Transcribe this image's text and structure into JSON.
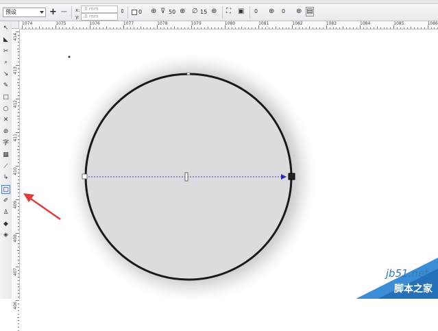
{
  "toolbar": {
    "preset_label": "预设",
    "offset_x": ".0 mm",
    "offset_y": ".0 mm",
    "angle_value": "0",
    "midpoint_value": "50",
    "edge_pad_value": "15",
    "rotation_value": "0",
    "spin_value": "0"
  },
  "ruler": {
    "h_labels": [
      "1074",
      "1075",
      "1076",
      "1077",
      "1078",
      "1079",
      "1080",
      "1081",
      "1082",
      "1083",
      "1084",
      "1085",
      "1086"
    ],
    "v_labels": [
      "414",
      "413",
      "412",
      "411",
      "410",
      "409",
      "408",
      "407",
      "406"
    ]
  },
  "toolbox": {
    "items": [
      {
        "name": "pick-tool",
        "glyph": "↖",
        "active": false
      },
      {
        "name": "shape-tool",
        "glyph": "◣",
        "active": false
      },
      {
        "name": "crop-tool",
        "glyph": "✂",
        "active": false
      },
      {
        "name": "zoom-tool",
        "glyph": "⌕",
        "active": false
      },
      {
        "name": "freehand-tool",
        "glyph": "↘",
        "active": false
      },
      {
        "name": "smart-fill-tool",
        "glyph": "✎",
        "active": false
      },
      {
        "name": "rectangle-tool",
        "glyph": "□",
        "active": false
      },
      {
        "name": "ellipse-tool",
        "glyph": "○",
        "active": false
      },
      {
        "name": "polygon-tool",
        "glyph": "✕",
        "active": false
      },
      {
        "name": "basic-shapes-tool",
        "glyph": "⊛",
        "active": false
      },
      {
        "name": "text-tool",
        "glyph": "字",
        "active": false
      },
      {
        "name": "table-tool",
        "glyph": "▦",
        "active": false
      },
      {
        "name": "dimension-tool",
        "glyph": "⟋",
        "active": false
      },
      {
        "name": "connector-tool",
        "glyph": "↳",
        "active": false
      },
      {
        "name": "drop-shadow-tool",
        "glyph": "▢",
        "active": true
      },
      {
        "name": "eyedropper-tool",
        "glyph": "✐",
        "active": false
      },
      {
        "name": "outline-tool",
        "glyph": "♙",
        "active": false
      },
      {
        "name": "fill-tool",
        "glyph": "◆",
        "active": false
      },
      {
        "name": "interactive-fill-tool",
        "glyph": "◈",
        "active": false
      }
    ]
  },
  "watermark": {
    "site": "jb51.net",
    "brand": "脚本之家"
  },
  "colors": {
    "circle_fill": "#dcdcde",
    "circle_stroke": "#1a1a1a",
    "vector_line": "#3a3ab8",
    "annotation_arrow": "#e03a3a"
  }
}
